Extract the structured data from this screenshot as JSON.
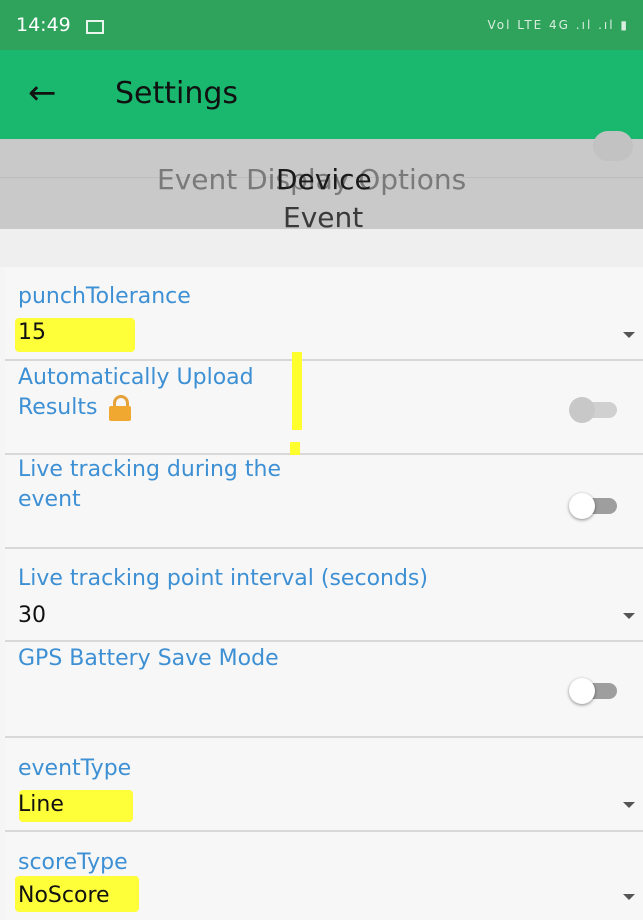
{
  "status_bar": {
    "time": "14:49",
    "icons": "Vol LTE 4G .ıl .ıl ▮"
  },
  "app_bar": {
    "title": "Settings"
  },
  "tabs": {
    "ghost_label": "Event Display Options",
    "active_label": "Device",
    "next_label": "Event"
  },
  "settings": {
    "punch_tolerance": {
      "label": "punchTolerance",
      "value": "15"
    },
    "auto_upload": {
      "label_line1": "Automatically Upload",
      "label_line2": "Results",
      "enabled": false,
      "locked": true
    },
    "live_tracking": {
      "label_line1": "Live tracking during the",
      "label_line2": "event",
      "enabled": false
    },
    "tracking_interval": {
      "label": "Live tracking point interval (seconds)",
      "value": "30"
    },
    "gps_battery": {
      "label": "GPS Battery Save Mode",
      "enabled": false
    },
    "event_type": {
      "label": "eventType",
      "value": "Line"
    },
    "score_type": {
      "label": "scoreType",
      "value": "NoScore"
    }
  },
  "colors": {
    "status_bar": "#2fa25c",
    "app_bar": "#19b86e",
    "label": "#3e90d4",
    "highlight": "#ffff2e"
  }
}
